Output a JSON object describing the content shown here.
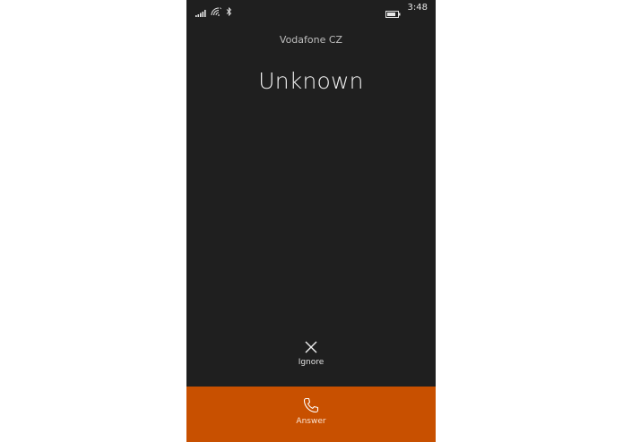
{
  "status_bar": {
    "time": "3:48",
    "icons": [
      "signal-icon",
      "wifi-icon",
      "bluetooth-icon",
      "battery-icon"
    ]
  },
  "call": {
    "carrier": "Vodafone CZ",
    "caller": "Unknown"
  },
  "actions": {
    "ignore_label": "Ignore",
    "ignore_icon": "close-icon",
    "answer_label": "Answer",
    "answer_icon": "phone-icon"
  },
  "colors": {
    "background": "#1f1f1f",
    "accent": "#c85000"
  }
}
